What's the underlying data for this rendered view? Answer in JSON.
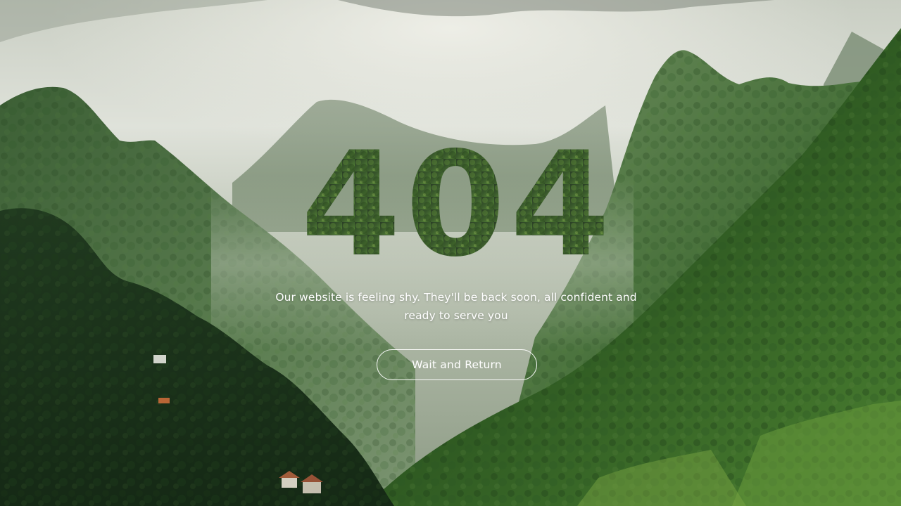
{
  "error_page": {
    "code": "404",
    "message": "Our website is feeling shy. They'll be back soon, all confident and ready to serve you",
    "button_label": "Wait and Return"
  },
  "background": {
    "description_icon": "mountain-valley-photo",
    "colors": {
      "sky": "#d9ddd4",
      "mist": "#a9b5a2",
      "mountain_far": "#7f9478",
      "mountain_mid": "#4f6e45",
      "forest_dark": "#1f3a1f",
      "forest_bright": "#3f7a2c"
    }
  },
  "accent_color": "#ffffff"
}
